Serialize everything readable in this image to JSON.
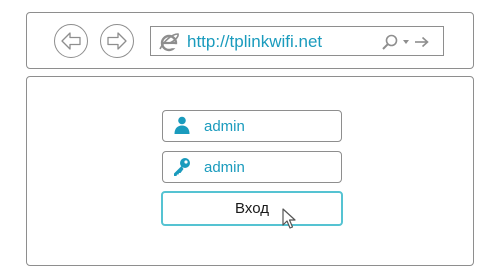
{
  "browser": {
    "url": "http://tplinkwifi.net",
    "nav_icons": [
      "back-arrow-icon",
      "forward-arrow-icon"
    ],
    "address_bar_icons": [
      "internet-explorer-icon",
      "search-icon",
      "chevron-down-icon",
      "go-arrow-icon"
    ]
  },
  "login": {
    "username": "admin",
    "password": "admin",
    "username_icon": "user-icon",
    "password_icon": "key-icon",
    "submit_label": "Вход"
  },
  "colors": {
    "accent": "#1a9bbd",
    "button_border": "#55c3d2",
    "frame_border": "#8e8e8e"
  }
}
